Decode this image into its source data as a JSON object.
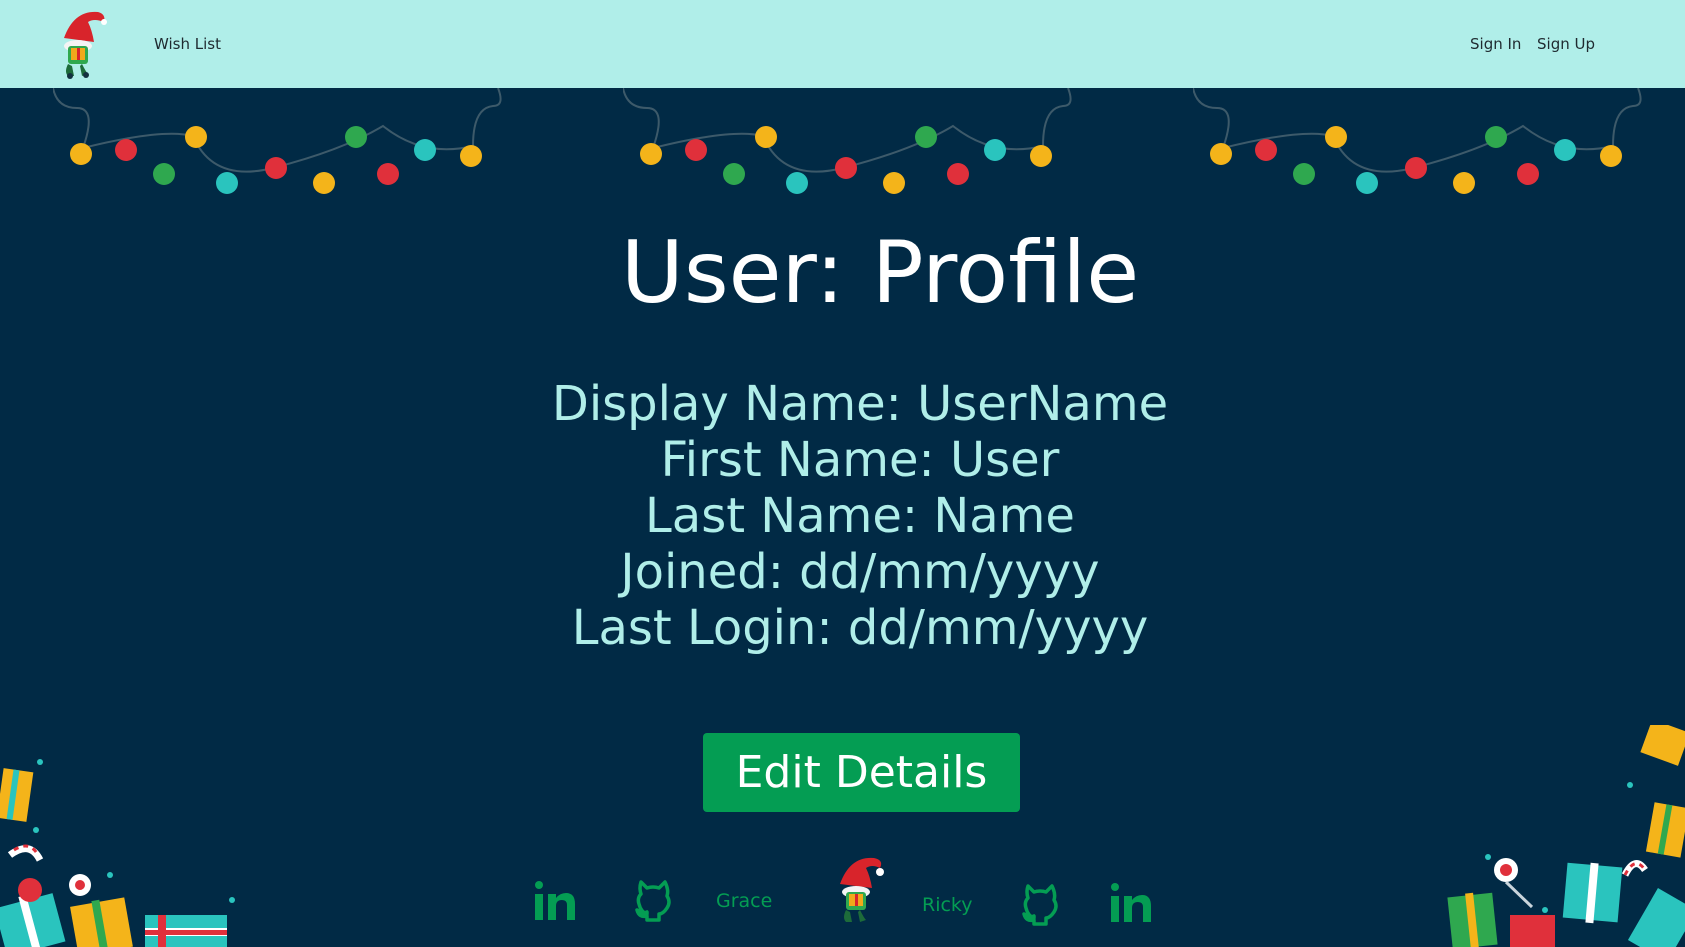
{
  "nav": {
    "wish_list": "Wish List",
    "sign_in": "Sign In",
    "sign_up": "Sign Up"
  },
  "profile": {
    "title": "User: Profile",
    "display_name": "Display Name: UserName",
    "first_name": "First Name: User",
    "last_name": "Last Name: Name",
    "joined": "Joined: dd/mm/yyyy",
    "last_login": "Last Login: dd/mm/yyyy",
    "edit_button": "Edit Details"
  },
  "footer": {
    "dev_1": "Grace",
    "dev_2": "Ricky"
  },
  "icons": {
    "logo": "gnome-logo-icon",
    "linkedin": "linkedin-icon",
    "github": "github-icon",
    "lights": "christmas-lights-decoration",
    "presents": "presents-decoration"
  },
  "colors": {
    "navbar": "#b0eee9",
    "background": "#012a45",
    "text_light": "#b0eee9",
    "button": "#049d53",
    "footer_green": "#049d53"
  }
}
